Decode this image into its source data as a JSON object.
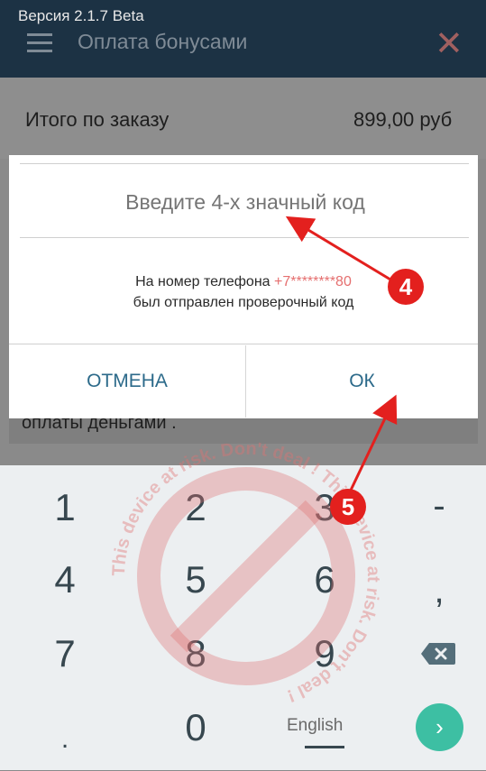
{
  "status_bar": {
    "version": "Версия 2.1.7 Beta"
  },
  "appbar": {
    "title": "Оплата бонусами",
    "menu_icon": "hamburger-menu-icon",
    "close_icon": "close-icon"
  },
  "order": {
    "total_label": "Итого по заказу",
    "total_value": "899,00 руб"
  },
  "background_text": "оплаты деньгами .",
  "dialog": {
    "code_placeholder": "Введите 4-х значный код",
    "message_line1_prefix": "На номер телефона ",
    "phone": "+7********80",
    "message_line2": "был отправлен проверочный код",
    "cancel_label": "ОТМЕНА",
    "ok_label": "ОК"
  },
  "keyboard": {
    "keys": [
      "1",
      "2",
      "3",
      "-",
      "4",
      "5",
      "6",
      ",",
      "7",
      "8",
      "9",
      "0"
    ],
    "language": "English",
    "backspace_icon": "backspace-icon",
    "enter_icon": "enter-arrow-icon"
  },
  "watermark": {
    "text": "This device at risk. Don't deal ! This device at risk. Don't deal !"
  },
  "annotations": {
    "badge4": "4",
    "badge5": "5"
  },
  "colors": {
    "appbar": "#1c3244",
    "accent_button": "#2c6a8a",
    "phone_red": "#e56f6f",
    "annotation_red": "#e3201e",
    "enter_green": "#3dbfa3"
  }
}
